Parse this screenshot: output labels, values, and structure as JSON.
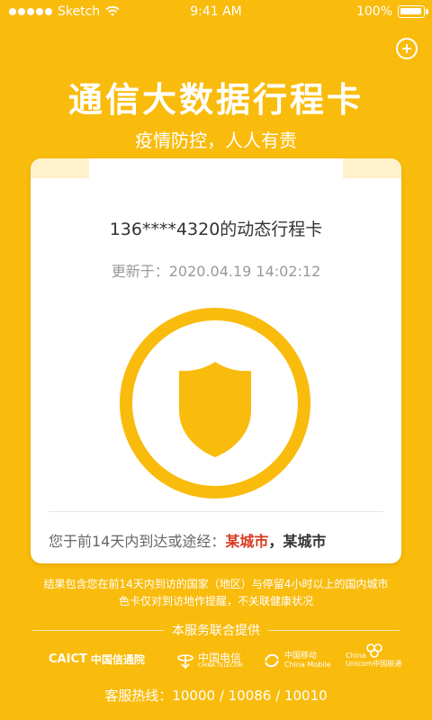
{
  "status_bar": {
    "carrier": "Sketch",
    "time": "9:41 AM",
    "battery": "100%",
    "battery_level": 1.0
  },
  "header": {
    "title": "通信大数据行程卡",
    "subtitle": "疫情防控，人人有责"
  },
  "card": {
    "phone_line": "136****4320的动态行程卡",
    "updated": "更新于：2020.04.19 14:02:12",
    "route_label": "您于前14天内到达或途经：",
    "city_1": "某城市",
    "separator": "，",
    "city_2": "某城市"
  },
  "disclaimer": {
    "line1": "结果包含您在前14天内到访的国家（地区）与停留4小时以上的国内城市",
    "line2": "色卡仅对到访地作提醒，不关联健康状况"
  },
  "providers": {
    "heading": "本服务联合提供",
    "caict_en": "CAICT",
    "caict_cn": "中国信通院",
    "telecom_cn": "中国电信",
    "telecom_en": "CHINA TELECOM",
    "mobile_cn": "中国移动",
    "mobile_en": "China Mobile",
    "unicom_en1": "China",
    "unicom_en2": "Unicom中国联通"
  },
  "hotline": "客服热线：10000 / 10086 / 10010",
  "colors": {
    "background": "#F9BB0C",
    "accent_red": "#D9391F",
    "card_band": "#FFF1CC"
  },
  "icons": [
    "wifi-icon",
    "battery-icon",
    "plus-icon",
    "shield-icon"
  ]
}
